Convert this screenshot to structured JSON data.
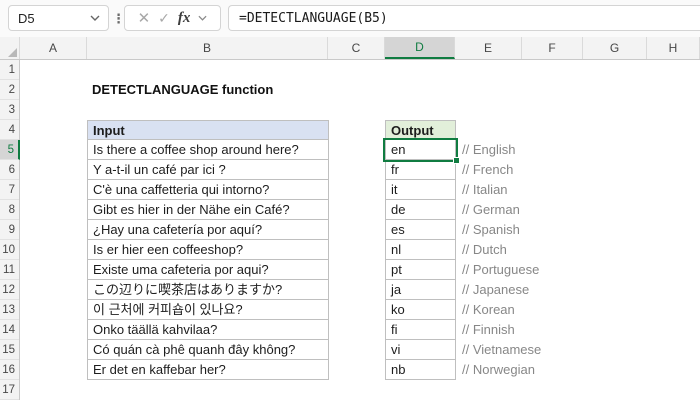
{
  "toolbar": {
    "name_box_value": "D5",
    "formula": "=DETECTLANGUAGE(B5)",
    "fx_label": "fx",
    "cancel_glyph": "✕",
    "enter_glyph": "✓"
  },
  "grid": {
    "column_headers": [
      "A",
      "B",
      "C",
      "D",
      "E",
      "F",
      "G",
      "H"
    ],
    "row_numbers": [
      1,
      2,
      3,
      4,
      5,
      6,
      7,
      8,
      9,
      10,
      11,
      12,
      13,
      14,
      15,
      16,
      17
    ],
    "selected_cell": "D5",
    "selected_column": "D",
    "selected_row": 5
  },
  "sheet": {
    "title": "DETECTLANGUAGE function",
    "input_header": "Input",
    "output_header": "Output",
    "rows": [
      {
        "row": 5,
        "input": "Is there a coffee shop around here?",
        "output": "en",
        "comment": "// English"
      },
      {
        "row": 6,
        "input": "Y a-t-il un café par ici ?",
        "output": "fr",
        "comment": "// French"
      },
      {
        "row": 7,
        "input": "C'è una caffetteria qui intorno?",
        "output": "it",
        "comment": "// Italian"
      },
      {
        "row": 8,
        "input": "Gibt es hier in der Nähe ein Café?",
        "output": "de",
        "comment": "// German"
      },
      {
        "row": 9,
        "input": "¿Hay una cafetería por aquí?",
        "output": "es",
        "comment": "// Spanish"
      },
      {
        "row": 10,
        "input": "Is er hier een coffeeshop?",
        "output": "nl",
        "comment": "// Dutch"
      },
      {
        "row": 11,
        "input": "Existe uma cafeteria por aqui?",
        "output": "pt",
        "comment": "// Portuguese"
      },
      {
        "row": 12,
        "input": "この辺りに喫茶店はありますか?",
        "output": "ja",
        "comment": "// Japanese"
      },
      {
        "row": 13,
        "input": "이 근처에 커피숍이 있나요?",
        "output": "ko",
        "comment": "// Korean"
      },
      {
        "row": 14,
        "input": "Onko täällä kahvilaa?",
        "output": "fi",
        "comment": "// Finnish"
      },
      {
        "row": 15,
        "input": "Có quán cà phê quanh đây không?",
        "output": "vi",
        "comment": "// Vietnamese"
      },
      {
        "row": 16,
        "input": "Er det en kaffebar her?",
        "output": "nb",
        "comment": "// Norwegian"
      }
    ]
  },
  "colors": {
    "excel_green": "#107C41",
    "input_header_fill": "#D9E1F2",
    "output_header_fill": "#E2EFDA",
    "selected_header_fill": "#D5D5D5",
    "table_border": "#BFBFBF",
    "comment_text": "#878787"
  }
}
